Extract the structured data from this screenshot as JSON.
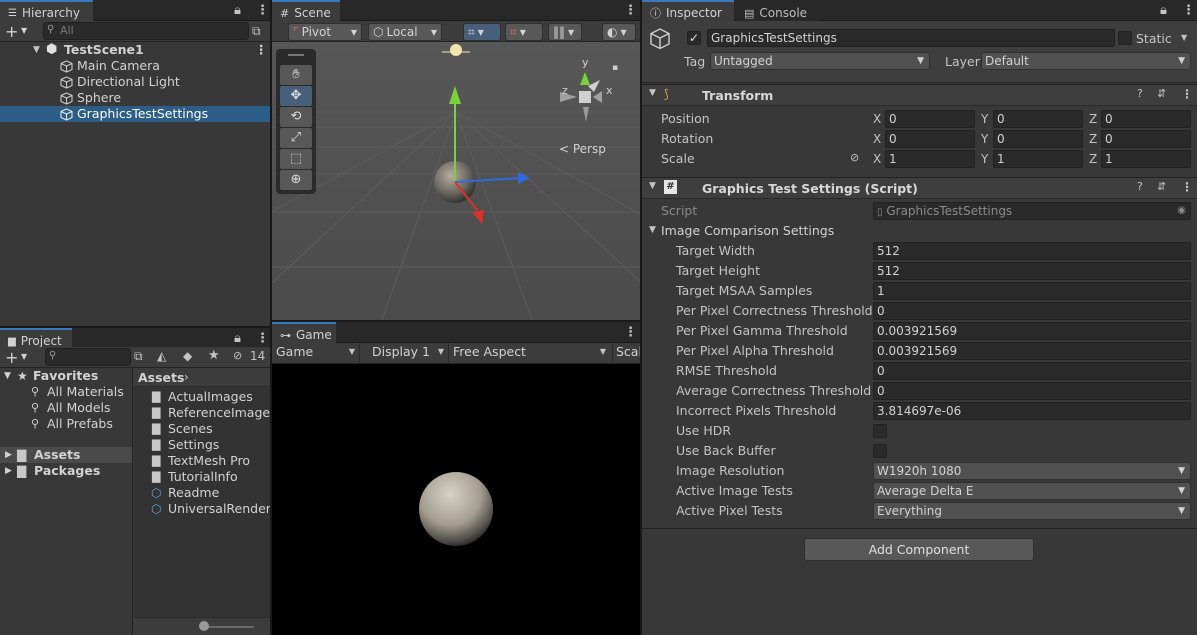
{
  "hierarchy": {
    "tab": "Hierarchy",
    "search_placeholder": "All",
    "scene": "TestScene1",
    "items": [
      {
        "label": "Main Camera"
      },
      {
        "label": "Directional Light"
      },
      {
        "label": "Sphere"
      },
      {
        "label": "GraphicsTestSettings",
        "selected": true
      }
    ]
  },
  "scene_view": {
    "tab": "Scene",
    "pivot": "Pivot",
    "local": "Local",
    "gizmo_axes": {
      "y": "y",
      "x": "x",
      "z": "z"
    },
    "projection": "< Persp"
  },
  "game_view": {
    "tab": "Game",
    "mode": "Game",
    "display": "Display 1",
    "aspect": "Free Aspect",
    "scale": "Scal"
  },
  "project": {
    "tab": "Project",
    "hidden_count": "14",
    "favorites_label": "Favorites",
    "favorites": [
      "All Materials",
      "All Models",
      "All Prefabs"
    ],
    "roots": [
      "Assets",
      "Packages"
    ],
    "breadcrumb": "Assets",
    "assets": [
      {
        "label": "ActualImages",
        "kind": "folder"
      },
      {
        "label": "ReferenceImages",
        "kind": "folder"
      },
      {
        "label": "Scenes",
        "kind": "folder"
      },
      {
        "label": "Settings",
        "kind": "folder"
      },
      {
        "label": "TextMesh Pro",
        "kind": "folder"
      },
      {
        "label": "TutorialInfo",
        "kind": "folder"
      },
      {
        "label": "Readme",
        "kind": "asset"
      },
      {
        "label": "UniversalRenderP",
        "kind": "asset"
      }
    ]
  },
  "inspector": {
    "tab": "Inspector",
    "console_tab": "Console",
    "object_name": "GraphicsTestSettings",
    "static_label": "Static",
    "tag_label": "Tag",
    "tag_value": "Untagged",
    "layer_label": "Layer",
    "layer_value": "Default",
    "transform": {
      "title": "Transform",
      "position": {
        "label": "Position",
        "x": "0",
        "y": "0",
        "z": "0"
      },
      "rotation": {
        "label": "Rotation",
        "x": "0",
        "y": "0",
        "z": "0"
      },
      "scale": {
        "label": "Scale",
        "x": "1",
        "y": "1",
        "z": "1"
      }
    },
    "script_component": {
      "title": "Graphics Test Settings (Script)",
      "script_label": "Script",
      "script_value": "GraphicsTestSettings",
      "group": "Image Comparison Settings",
      "fields": [
        {
          "label": "Target Width",
          "value": "512",
          "kind": "text"
        },
        {
          "label": "Target Height",
          "value": "512",
          "kind": "text"
        },
        {
          "label": "Target MSAA Samples",
          "value": "1",
          "kind": "text"
        },
        {
          "label": "Per Pixel Correctness Threshold",
          "value": "0",
          "kind": "text"
        },
        {
          "label": "Per Pixel Gamma Threshold",
          "value": "0.003921569",
          "kind": "text"
        },
        {
          "label": "Per Pixel Alpha Threshold",
          "value": "0.003921569",
          "kind": "text"
        },
        {
          "label": "RMSE Threshold",
          "value": "0",
          "kind": "text"
        },
        {
          "label": "Average Correctness Threshold",
          "value": "0",
          "kind": "text"
        },
        {
          "label": "Incorrect Pixels Threshold",
          "value": "3.814697e-06",
          "kind": "text"
        },
        {
          "label": "Use HDR",
          "value": "",
          "kind": "checkbox"
        },
        {
          "label": "Use Back Buffer",
          "value": "",
          "kind": "checkbox"
        },
        {
          "label": "Image Resolution",
          "value": "W1920h 1080",
          "kind": "dropdown"
        },
        {
          "label": "Active Image Tests",
          "value": "Average Delta E",
          "kind": "dropdown"
        },
        {
          "label": "Active Pixel Tests",
          "value": "Everything",
          "kind": "dropdown"
        }
      ]
    },
    "add_component": "Add Component"
  },
  "colors": {
    "accent": "#3a79bb",
    "selection": "#2c5d87",
    "panel": "#383838"
  }
}
